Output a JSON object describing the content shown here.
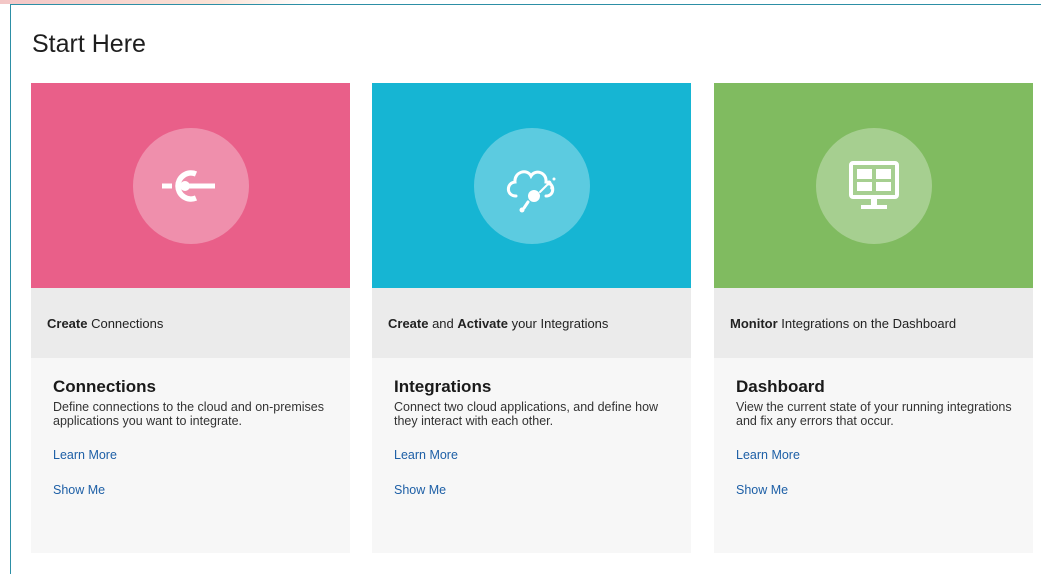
{
  "page": {
    "title": "Start Here"
  },
  "colors": {
    "connections": "#e95f89",
    "integrations": "#16b5d3",
    "dashboard": "#80bb60",
    "link": "#1d5fa6",
    "frame": "#2d8fa6"
  },
  "cards": [
    {
      "icon": "connector-plug-icon",
      "step": [
        {
          "text": "Create",
          "bold": true
        },
        {
          "text": " Connections",
          "bold": false
        }
      ],
      "title": "Connections",
      "description": "Define connections to the cloud and on-premises applications you want to integrate.",
      "learn_more": "Learn More",
      "show_me": "Show Me"
    },
    {
      "icon": "cloud-integration-icon",
      "step": [
        {
          "text": "Create",
          "bold": true
        },
        {
          "text": " and ",
          "bold": false
        },
        {
          "text": "Activate",
          "bold": true
        },
        {
          "text": " your Integrations",
          "bold": false
        }
      ],
      "title": "Integrations",
      "description": "Connect two cloud applications, and define how they interact with each other.",
      "learn_more": "Learn More",
      "show_me": "Show Me"
    },
    {
      "icon": "monitor-dashboard-icon",
      "step": [
        {
          "text": "Monitor",
          "bold": true
        },
        {
          "text": " Integrations on the Dashboard",
          "bold": false
        }
      ],
      "title": "Dashboard",
      "description": "View the current state of your running integrations and fix any errors that occur.",
      "learn_more": "Learn More",
      "show_me": "Show Me"
    }
  ]
}
